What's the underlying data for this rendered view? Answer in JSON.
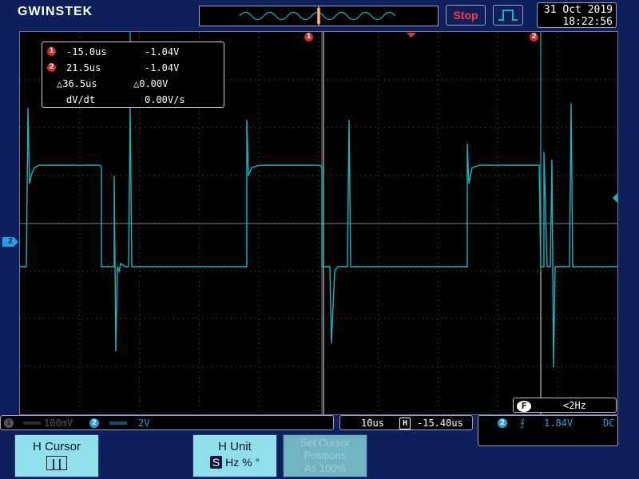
{
  "brand": "GWINSTEK",
  "status": {
    "run_state": "Stop"
  },
  "datetime": {
    "date": "31 Oct 2019",
    "time": "18:22:56"
  },
  "markers": {
    "ch2_label": "2",
    "cursor1_label": "1",
    "cursor2_label": "2"
  },
  "cursor_readout": {
    "row1": {
      "badge": "1",
      "time": "-15.0us",
      "volt": "-1.04V"
    },
    "row2": {
      "badge": "2",
      "time": "21.5us",
      "volt": "-1.04V"
    },
    "row3": {
      "time": "△36.5us",
      "volt": "△0.00V"
    },
    "row4": {
      "label": "dV/dt",
      "value": "0.00V/s"
    }
  },
  "frequency": {
    "badge": "F",
    "value": "<2Hz"
  },
  "bottom": {
    "ch1": {
      "badge": "1",
      "coupling": "═══",
      "scale": "100mV"
    },
    "ch2": {
      "badge": "2",
      "coupling": "═══",
      "scale": "2V"
    },
    "timebase": {
      "scale": "10us",
      "badge": "H",
      "position": "-15.40us"
    },
    "trigger": {
      "badge": "2",
      "slope": "⨍",
      "level": "1.84V",
      "coupling": "DC"
    }
  },
  "softkeys": {
    "h_cursor": {
      "title": "H Cursor",
      "value": "| |"
    },
    "h_unit": {
      "title": "H Unit",
      "badge": "S",
      "options": "Hz % °"
    },
    "set_cursor": {
      "line1": "Set Cursor",
      "line2": "Positions",
      "line3": "As 100%"
    }
  },
  "colors": {
    "trace": "#18b5c0",
    "grid": "#5a5a5a",
    "cursor": "#e8e8e8",
    "background": "#0f1f5c"
  }
}
